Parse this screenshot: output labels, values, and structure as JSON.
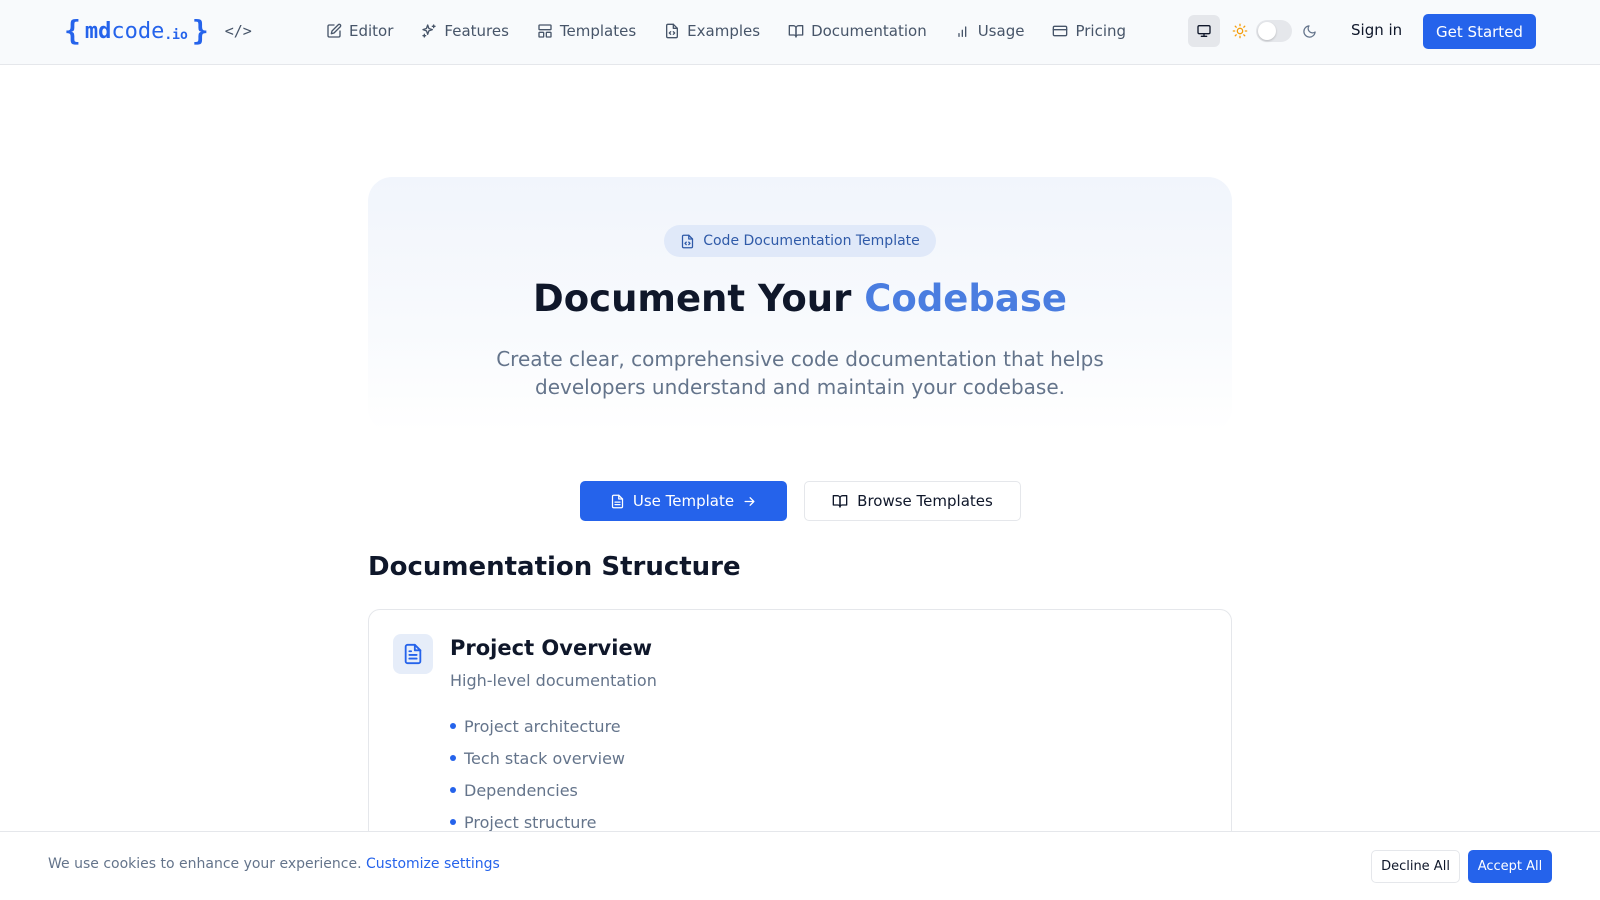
{
  "header": {
    "logo": {
      "brace_open": "{",
      "md": "md",
      "code": "code",
      "tld": ".io",
      "brace_close": "}",
      "tag": "</>"
    },
    "nav": [
      {
        "label": "Editor",
        "icon": "edit-icon"
      },
      {
        "label": "Features",
        "icon": "sparkles-icon"
      },
      {
        "label": "Templates",
        "icon": "layout-icon"
      },
      {
        "label": "Examples",
        "icon": "file-code-icon"
      },
      {
        "label": "Documentation",
        "icon": "book-open-icon"
      },
      {
        "label": "Usage",
        "icon": "bar-chart-icon"
      },
      {
        "label": "Pricing",
        "icon": "credit-card-icon"
      }
    ],
    "theme_icons": [
      "monitor-icon",
      "sun-icon",
      "moon-icon"
    ],
    "sign_in": "Sign in",
    "get_started": "Get Started"
  },
  "hero": {
    "badge": "Code Documentation Template",
    "title_main": "Document Your ",
    "title_accent": "Codebase",
    "subtitle": "Create clear, comprehensive code documentation that helps developers understand and maintain your codebase."
  },
  "cta": {
    "use_template": "Use Template",
    "browse_templates": "Browse Templates"
  },
  "structure": {
    "title": "Documentation Structure",
    "card": {
      "title": "Project Overview",
      "subtitle": "High-level documentation",
      "items": [
        "Project architecture",
        "Tech stack overview",
        "Dependencies",
        "Project structure"
      ]
    }
  },
  "cookie": {
    "text": "We use cookies to enhance your experience.",
    "link": "Customize settings",
    "decline": "Decline All",
    "accept": "Accept All"
  },
  "colors": {
    "primary": "#2563eb",
    "accent_title": "#4a7de0",
    "muted_text": "#64748b"
  }
}
